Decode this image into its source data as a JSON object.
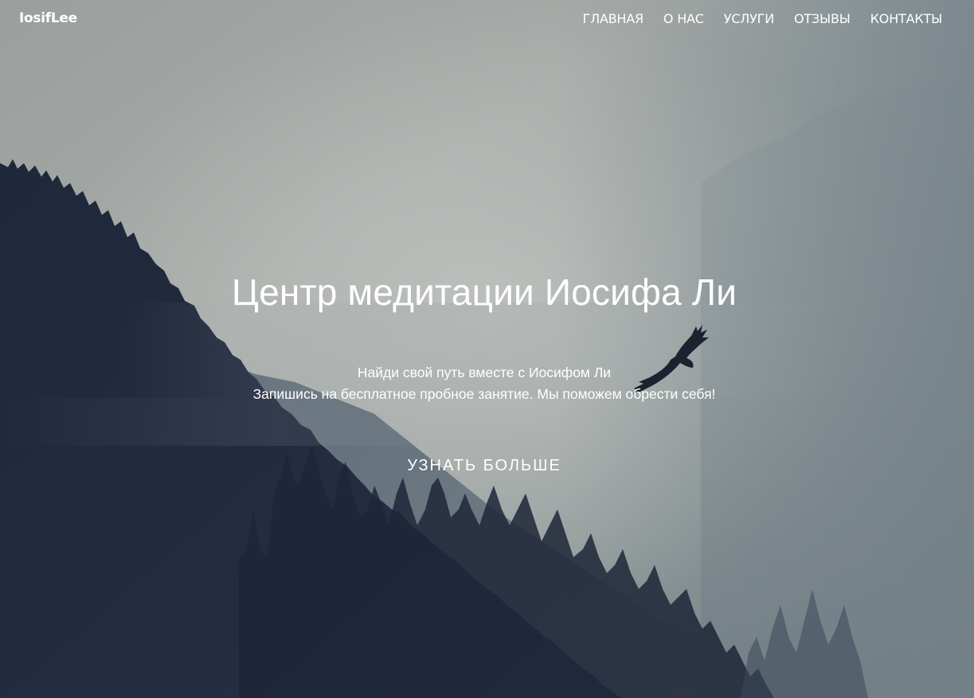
{
  "brand": {
    "name": "IosifLee"
  },
  "nav": {
    "items": [
      {
        "label": "ГЛАВНАЯ"
      },
      {
        "label": "О НАС"
      },
      {
        "label": "УСЛУГИ"
      },
      {
        "label": "ОТЗЫВЫ"
      },
      {
        "label": "КОНТАКТЫ"
      }
    ]
  },
  "hero": {
    "title": "Центр медитации Иосифа Ли",
    "subtitle_line1": "Найди свой путь вместе с Иосифом Ли",
    "subtitle_line2": "Запишись на бесплатное пробное занятие. Мы поможем обрести себя!",
    "cta_label": "УЗНАТЬ БОЛЬШЕ",
    "background_image": "misty-forest-mountain-icon",
    "bird_image": "flying-eagle-icon"
  },
  "colors": {
    "text": "#ffffff",
    "sky": "#9ea3a2",
    "forest_dark": "#1c2233"
  }
}
